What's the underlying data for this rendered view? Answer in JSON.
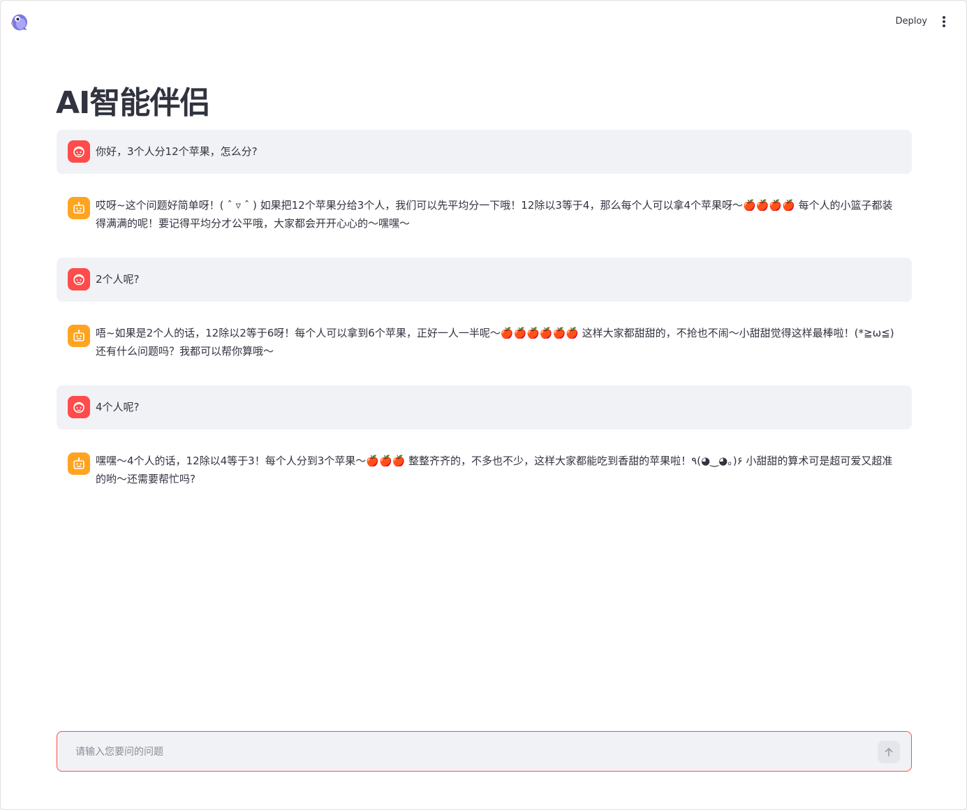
{
  "header": {
    "deploy_label": "Deploy"
  },
  "page": {
    "title": "AI智能伴侣"
  },
  "messages": [
    {
      "role": "user",
      "text": "你好，3个人分12个苹果，怎么分?"
    },
    {
      "role": "assistant",
      "text": "哎呀~这个问题好简单呀！( ˆ ▿ ˆ ) 如果把12个苹果分给3个人，我们可以先平均分一下哦！12除以3等于4，那么每个人可以拿4个苹果呀～🍎🍎🍎🍎 每个人的小篮子都装得满满的呢！要记得平均分才公平哦，大家都会开开心心的～嘿嘿～"
    },
    {
      "role": "user",
      "text": "2个人呢?"
    },
    {
      "role": "assistant",
      "text": "唔~如果是2个人的话，12除以2等于6呀！每个人可以拿到6个苹果，正好一人一半呢～🍎🍎🍎🍎🍎🍎 这样大家都甜甜的，不抢也不闹～小甜甜觉得这样最棒啦！(*≧ω≦) 还有什么问题吗？我都可以帮你算哦～"
    },
    {
      "role": "user",
      "text": "4个人呢?"
    },
    {
      "role": "assistant",
      "text": "嘿嘿～4个人的话，12除以4等于3！每个人分到3个苹果～🍎🍎🍎 整整齐齐的，不多也不少，这样大家都能吃到香甜的苹果啦！٩(◕‿◕｡)۶ 小甜甜的算术可是超可爱又超准的哟～还需要帮忙吗?"
    }
  ],
  "chat_input": {
    "placeholder": "请输入您要问的问题"
  },
  "colors": {
    "user_avatar": "#ff4b4b",
    "assistant_avatar": "#ffa421",
    "input_border": "#ff4b4b",
    "user_bubble": "#f0f2f6"
  },
  "icons": {
    "logo": "bird-logo-icon",
    "menu": "kebab-menu-icon",
    "user_avatar": "user-face-icon",
    "assistant_avatar": "robot-face-icon",
    "send": "arrow-up-icon"
  }
}
